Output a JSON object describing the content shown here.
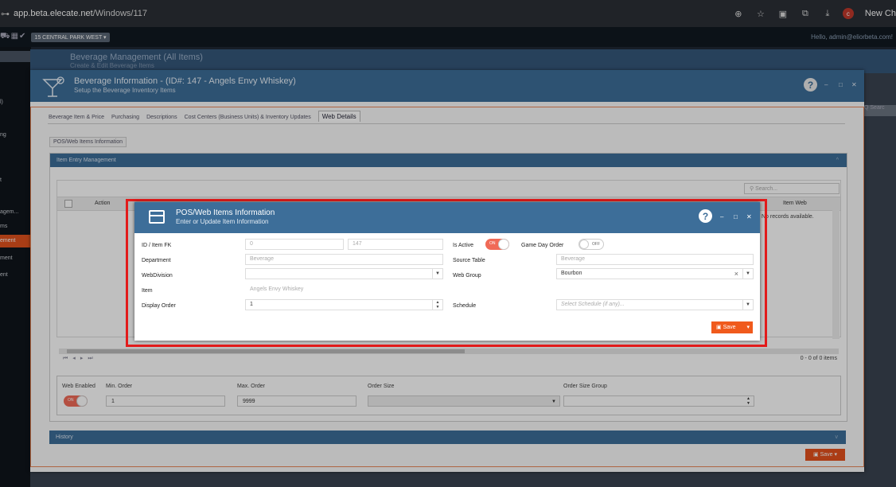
{
  "browser": {
    "url_domain": "app.beta.elecate.net",
    "url_path": "/Windows/117",
    "new_tab_label": "New Ch",
    "profile_initial": "c"
  },
  "app": {
    "location_label": "15 CENTRAL PARK WEST",
    "greeting": "Hello, admin@eliorbeta.com!"
  },
  "nav": {
    "items": [
      "l)",
      "ng",
      "t",
      "ement",
      "agem...",
      "ms",
      "ment",
      "ent"
    ]
  },
  "background_window": {
    "title": "Beverage Management (All Items)",
    "subtitle": "Create & Edit Beverage Items",
    "search_label": "Q Searc"
  },
  "main_window": {
    "title": "Beverage Information - (ID#: 147 - Angels Envy Whiskey)",
    "subtitle": "Setup the Beverage Inventory Items",
    "tabs": [
      "Beverage Item & Price",
      "Purchasing",
      "Descriptions",
      "Cost Centers (Business Units) & Inventory Updates",
      "Web Details"
    ],
    "subtab": "POS/Web Items Information",
    "panel_title": "Item Entry Management",
    "grid": {
      "search_placeholder": "Search...",
      "col_action": "Action",
      "col_item_web": "Item Web",
      "no_records": "No records available.",
      "count": "0 - 0 of 0 items"
    },
    "bottom": {
      "web_enabled_label": "Web Enabled",
      "web_enabled_toggle": "ON",
      "min_order_label": "Min. Order",
      "min_order_value": "1",
      "max_order_label": "Max. Order",
      "max_order_value": "9999",
      "order_size_label": "Order Size",
      "order_size_group_label": "Order Size Group"
    },
    "history_label": "History",
    "save_label": "Save"
  },
  "modal": {
    "title": "POS/Web Items Information",
    "subtitle": "Enter or Update Item Information",
    "fields": {
      "id_label": "ID / Item FK",
      "id_value": "0",
      "fk_value": "147",
      "is_active_label": "Is Active",
      "is_active_toggle": "ON",
      "game_day_label": "Game Day Order",
      "game_day_toggle": "OFF",
      "department_label": "Department",
      "department_value": "Beverage",
      "source_table_label": "Source Table",
      "source_table_value": "Beverage",
      "webdivision_label": "WebDivision",
      "webdivision_value": "",
      "web_group_label": "Web Group",
      "web_group_value": "Bourbon",
      "item_label": "Item",
      "item_value": "Angels Envy Whiskey",
      "display_order_label": "Display Order",
      "display_order_value": "1",
      "schedule_label": "Schedule",
      "schedule_placeholder": "Select Schedule (if any)..."
    },
    "save_label": "Save"
  },
  "colors": {
    "header_blue": "#3d6e99",
    "accent_orange": "#f05a1c",
    "highlight_red": "#e21b1b",
    "toggle_on": "#f06a57"
  }
}
